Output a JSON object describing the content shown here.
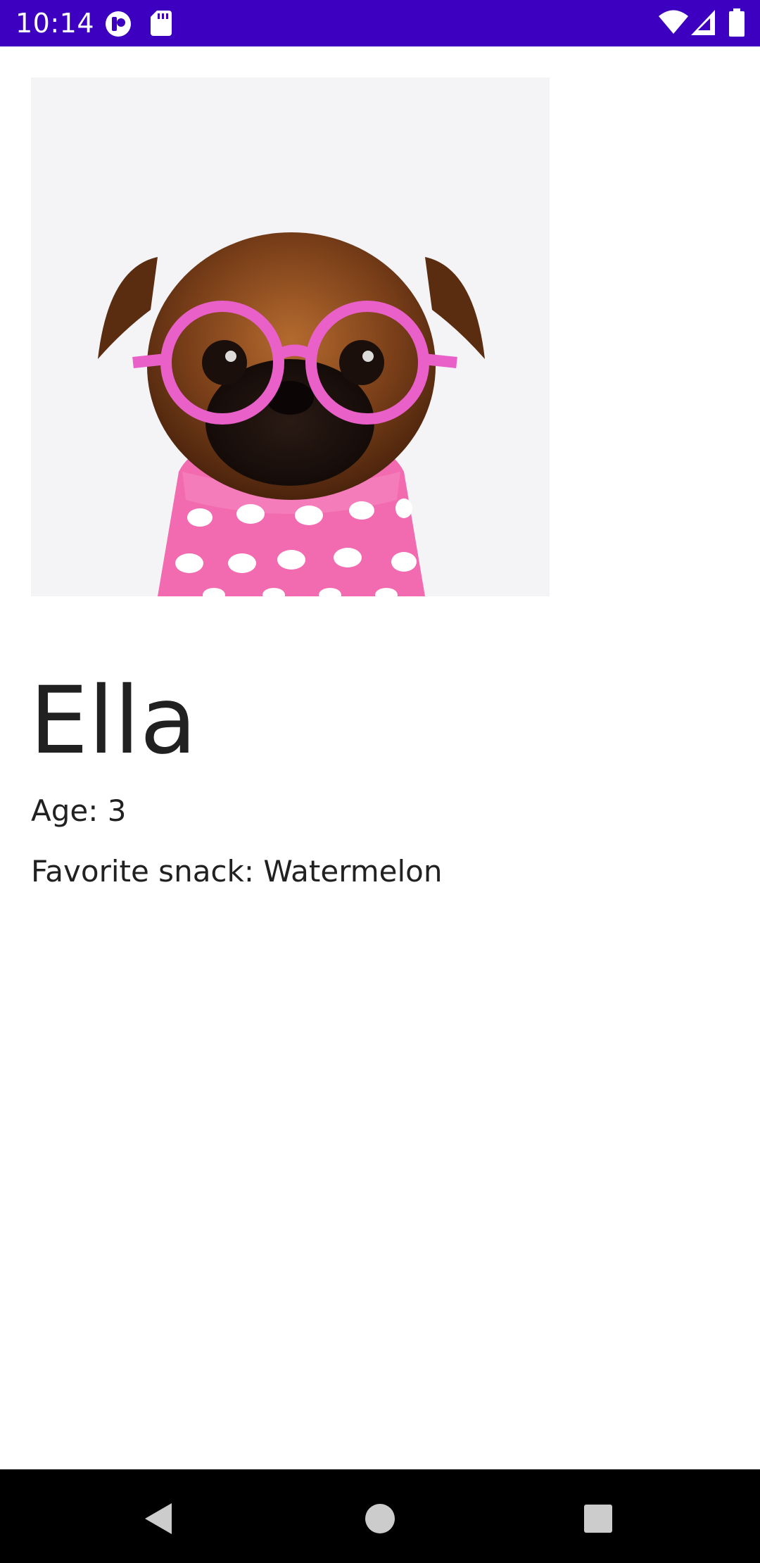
{
  "status_bar": {
    "time": "10:14",
    "color": "#3d00c0",
    "left_icons": [
      "app-notification-icon",
      "sd-card-icon"
    ],
    "right_icons": [
      "wifi-icon",
      "cell-signal-icon",
      "battery-icon"
    ]
  },
  "pet": {
    "photo_icon": "pet-photo",
    "name": "Ella",
    "age": "Age: 3",
    "favorite_snack": "Favorite snack: Watermelon"
  },
  "nav_bar": {
    "buttons": [
      "back-icon",
      "home-icon",
      "recents-icon"
    ]
  }
}
